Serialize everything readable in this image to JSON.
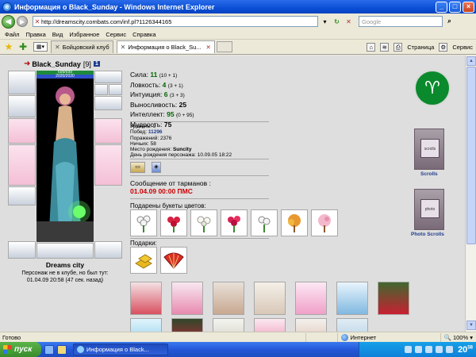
{
  "window": {
    "title": "Информация о Black_Sunday - Windows Internet Explorer"
  },
  "address": {
    "url": "http://dreamscity.combats.com/inf.pl?1126344165",
    "search_placeholder": "Google"
  },
  "menu": [
    "Файл",
    "Правка",
    "Вид",
    "Избранное",
    "Сервис",
    "Справка"
  ],
  "tabs": [
    {
      "label": "Бойцовский клуб"
    },
    {
      "label": "Информация о Black_Su..."
    }
  ],
  "toolbar_right": {
    "page": "Страница",
    "tools": "Сервис"
  },
  "character": {
    "name": "Black_Sunday",
    "level": "[9]",
    "badge": "1",
    "hp": "699/699",
    "mana": "2020/2020",
    "city": "Dreams city",
    "status_line1": "Персонаж не в клубе, но был тут:",
    "status_line2": "01.04.09 20:58 (47 сек. назад)"
  },
  "stats": [
    {
      "label": "Сила:",
      "value": "11",
      "extra": "(10 + 1)",
      "green": true
    },
    {
      "label": "Ловкость:",
      "value": "4",
      "extra": "(3 + 1)",
      "green": true
    },
    {
      "label": "Интуиция:",
      "value": "6",
      "extra": "(3 + 3)",
      "green": true
    },
    {
      "label": "Выносливость:",
      "value": "25",
      "extra": "",
      "green": false
    },
    {
      "label": "Интеллект:",
      "value": "95",
      "extra": "(0 + 95)",
      "green": true
    },
    {
      "label": "Мудрость:",
      "value": "75",
      "extra": "",
      "green": false
    }
  ],
  "info": {
    "level": "Уровень: 9",
    "wins_label": "Побед:",
    "wins": "11296",
    "losses": "Поражений: 2376",
    "draws": "Ничьих: 58",
    "birthplace_label": "Место рождения:",
    "birthplace": "Suncity",
    "birthday": "День рождения персонажа: 10.09.05 18:22"
  },
  "message": {
    "label": "Сообщение от тарманов :",
    "date": "01.04.09 00:00 ПМС"
  },
  "bouquets_label": "Подарены букеты цветов:",
  "gifts_label": "Подарки:",
  "right": {
    "scrolls": "Scrolls",
    "photo_scrolls": "Photo Scrolls",
    "banner1_text": "scrolls",
    "banner2_text": "photo"
  },
  "statusbar": {
    "ready": "Готово",
    "zone": "Интернет",
    "zoom": "100%"
  },
  "taskbar": {
    "start": "пуск",
    "task": "Информация о Black...",
    "clock": "20",
    "clock_sup": "58"
  }
}
